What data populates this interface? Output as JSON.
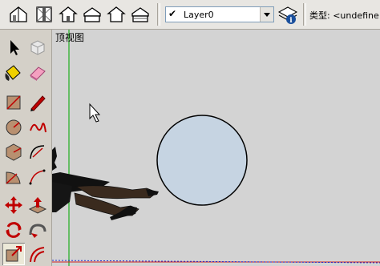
{
  "toolbar": {
    "buttons": [
      {
        "name": "iso-view-button",
        "icon": "house-iso-icon"
      },
      {
        "name": "top-view-button",
        "icon": "house-top-icon"
      },
      {
        "name": "front-view-button",
        "icon": "house-front-icon"
      },
      {
        "name": "right-view-button",
        "icon": "house-right-icon"
      },
      {
        "name": "back-view-button",
        "icon": "house-back-icon"
      },
      {
        "name": "left-view-button",
        "icon": "house-left-icon"
      }
    ],
    "layer": {
      "check": "✔",
      "name": "Layer0"
    },
    "layer_manager_icon": "layer-manager-icon",
    "type_label": "类型: <undefine"
  },
  "palette": {
    "tools": [
      {
        "name": "select-tool",
        "icon": "arrow-icon"
      },
      {
        "name": "make-component-tool",
        "icon": "component-icon"
      },
      {
        "name": "paint-bucket-tool",
        "icon": "paint-bucket-icon"
      },
      {
        "name": "eraser-tool",
        "icon": "eraser-icon"
      },
      {
        "name": "rectangle-tool",
        "icon": "rectangle-icon"
      },
      {
        "name": "line-tool",
        "icon": "pencil-icon"
      },
      {
        "name": "circle-tool",
        "icon": "circle-icon"
      },
      {
        "name": "freehand-tool",
        "icon": "freehand-icon"
      },
      {
        "name": "polygon-tool",
        "icon": "polygon-icon"
      },
      {
        "name": "arc-tool",
        "icon": "arc-icon"
      },
      {
        "name": "pie-tool",
        "icon": "pie-icon"
      },
      {
        "name": "arc-3pt-tool",
        "icon": "arc-3pt-icon"
      },
      {
        "name": "move-tool",
        "icon": "move-icon"
      },
      {
        "name": "push-pull-tool",
        "icon": "push-pull-icon"
      },
      {
        "name": "rotate-tool",
        "icon": "rotate-icon"
      },
      {
        "name": "follow-me-tool",
        "icon": "follow-me-icon"
      },
      {
        "name": "scale-tool",
        "icon": "scale-icon"
      },
      {
        "name": "offset-tool",
        "icon": "offset-icon"
      }
    ],
    "active": "scale-tool"
  },
  "viewport": {
    "title": "顶视图",
    "background": "#d3d3d3",
    "circle_fill": "#c6d4e2",
    "axis_green": "#1fae1f",
    "axis_red": "#d02020",
    "axis_blue": "#2030d0"
  }
}
